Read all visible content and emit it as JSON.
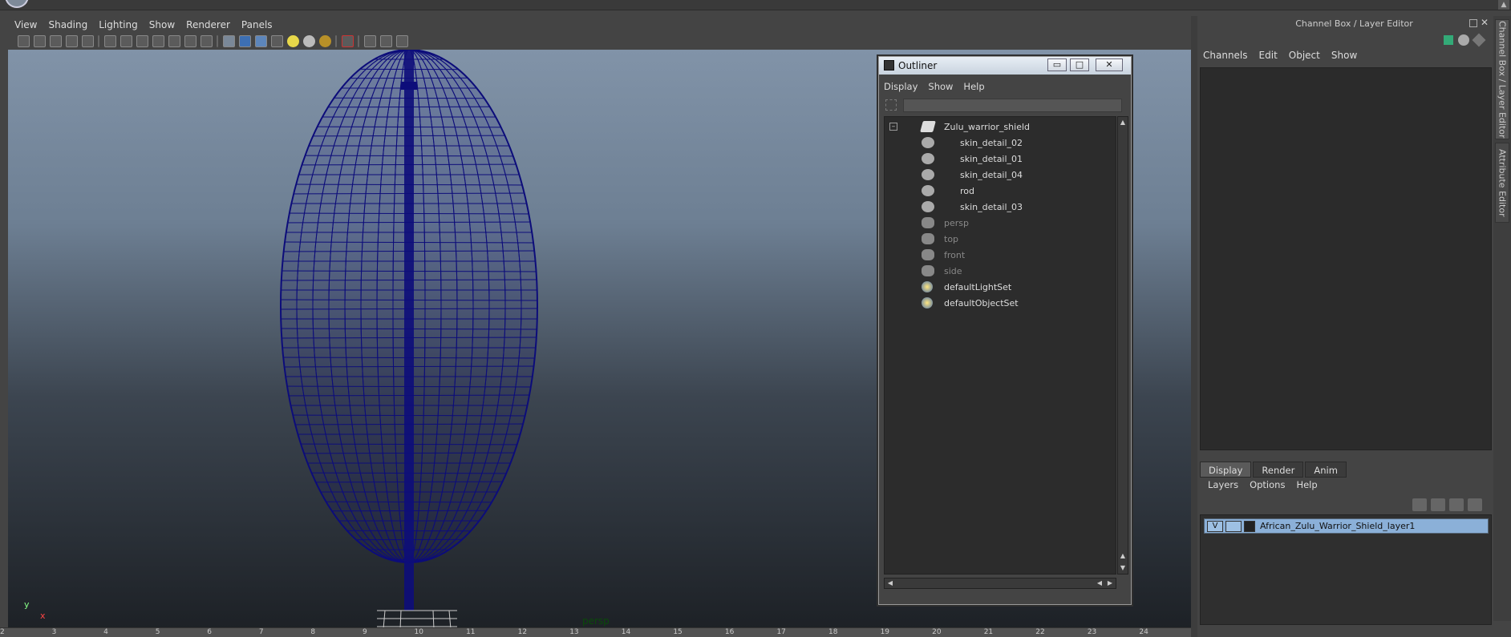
{
  "viewport": {
    "menus": [
      "View",
      "Shading",
      "Lighting",
      "Show",
      "Renderer",
      "Panels"
    ],
    "camera_label": "persp",
    "axis_x": "x",
    "axis_y": "y"
  },
  "timeline": {
    "ticks": [
      "2",
      "3",
      "4",
      "5",
      "6",
      "7",
      "8",
      "9",
      "10",
      "11",
      "12",
      "13",
      "14",
      "15",
      "16",
      "17",
      "18",
      "19",
      "20",
      "21",
      "22",
      "23",
      "24"
    ]
  },
  "outliner": {
    "title": "Outliner",
    "menus": [
      "Display",
      "Show",
      "Help"
    ],
    "buttons": {
      "minimize": "▭",
      "maximize": "□",
      "close": "✕"
    },
    "root": "Zulu_warrior_shield",
    "children": [
      "skin_detail_02",
      "skin_detail_01",
      "skin_detail_04",
      "rod",
      "skin_detail_03"
    ],
    "cameras": [
      "persp",
      "top",
      "front",
      "side"
    ],
    "sets": [
      "defaultLightSet",
      "defaultObjectSet"
    ]
  },
  "channel_box": {
    "title": "Channel Box / Layer Editor",
    "menus": [
      "Channels",
      "Edit",
      "Object",
      "Show"
    ]
  },
  "side_tabs": [
    "Channel Box / Layer Editor",
    "Attribute Editor"
  ],
  "layer_editor": {
    "tabs": [
      "Display",
      "Render",
      "Anim"
    ],
    "active_tab": "Display",
    "menus": [
      "Layers",
      "Options",
      "Help"
    ],
    "layer": {
      "visible": "V",
      "name": "African_Zulu_Warrior_Shield_layer1"
    }
  },
  "colors": {
    "wireframe": "#0d0d7a",
    "layer_highlight": "#8bb0d8"
  }
}
